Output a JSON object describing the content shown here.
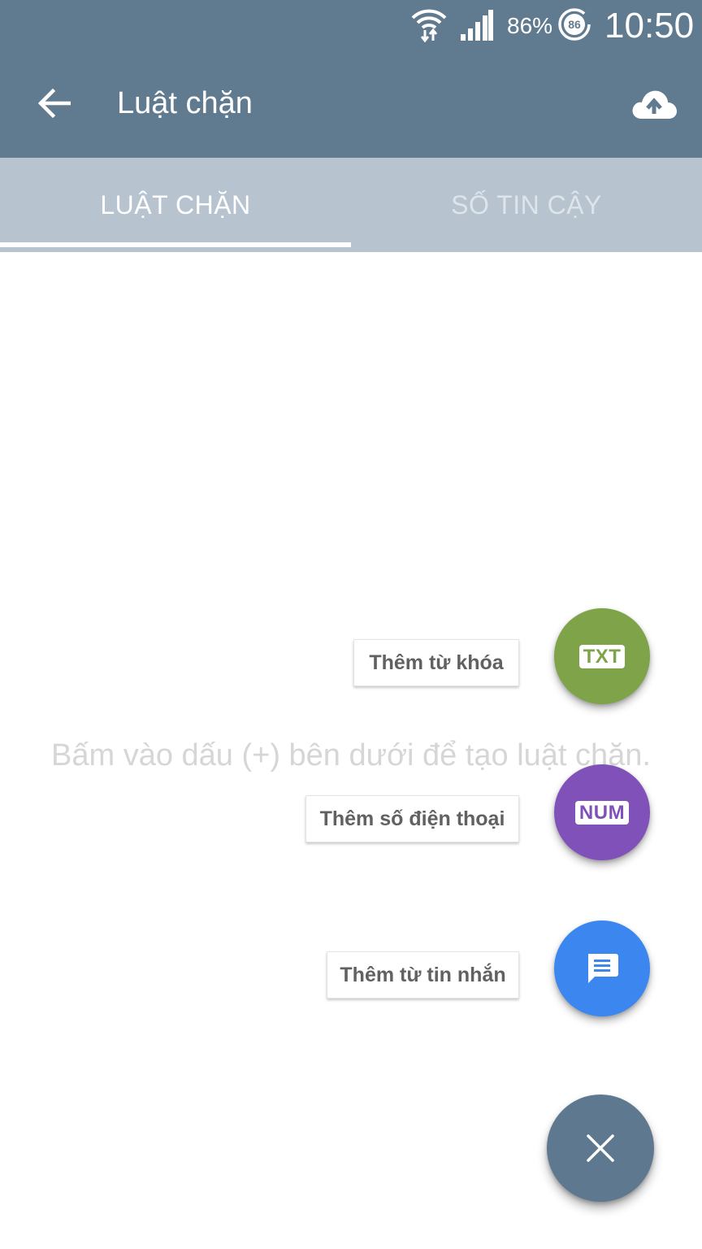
{
  "status_bar": {
    "battery_percent": "86%",
    "battery_icon_value": "86",
    "time": "10:50",
    "icons": [
      "wifi-icon",
      "cell-signal-icon",
      "battery-icon"
    ]
  },
  "toolbar": {
    "title": "Luật chặn",
    "back_icon": "arrow-back-icon",
    "upload_icon": "cloud-upload-icon"
  },
  "tabs": [
    {
      "label": "LUẬT CHẶN",
      "active": true
    },
    {
      "label": "SỐ TIN CẬY",
      "active": false
    }
  ],
  "empty_state": {
    "hint": "Bấm vào dấu (+) bên dưới để tạo luật chặn."
  },
  "speed_dial": {
    "actions": [
      {
        "label": "Thêm từ khóa",
        "badge": "TXT",
        "color": "#7ea348"
      },
      {
        "label": "Thêm số điện thoại",
        "badge": "NUM",
        "color": "#8052b9"
      },
      {
        "label": "Thêm từ tin nhắn",
        "icon": "message-icon",
        "color": "#3c86f0"
      }
    ],
    "close_icon": "close-icon",
    "main_color": "#5d788f"
  },
  "colors": {
    "app_bar": "#607a8f",
    "tab_bar": "#b7c3cf"
  }
}
